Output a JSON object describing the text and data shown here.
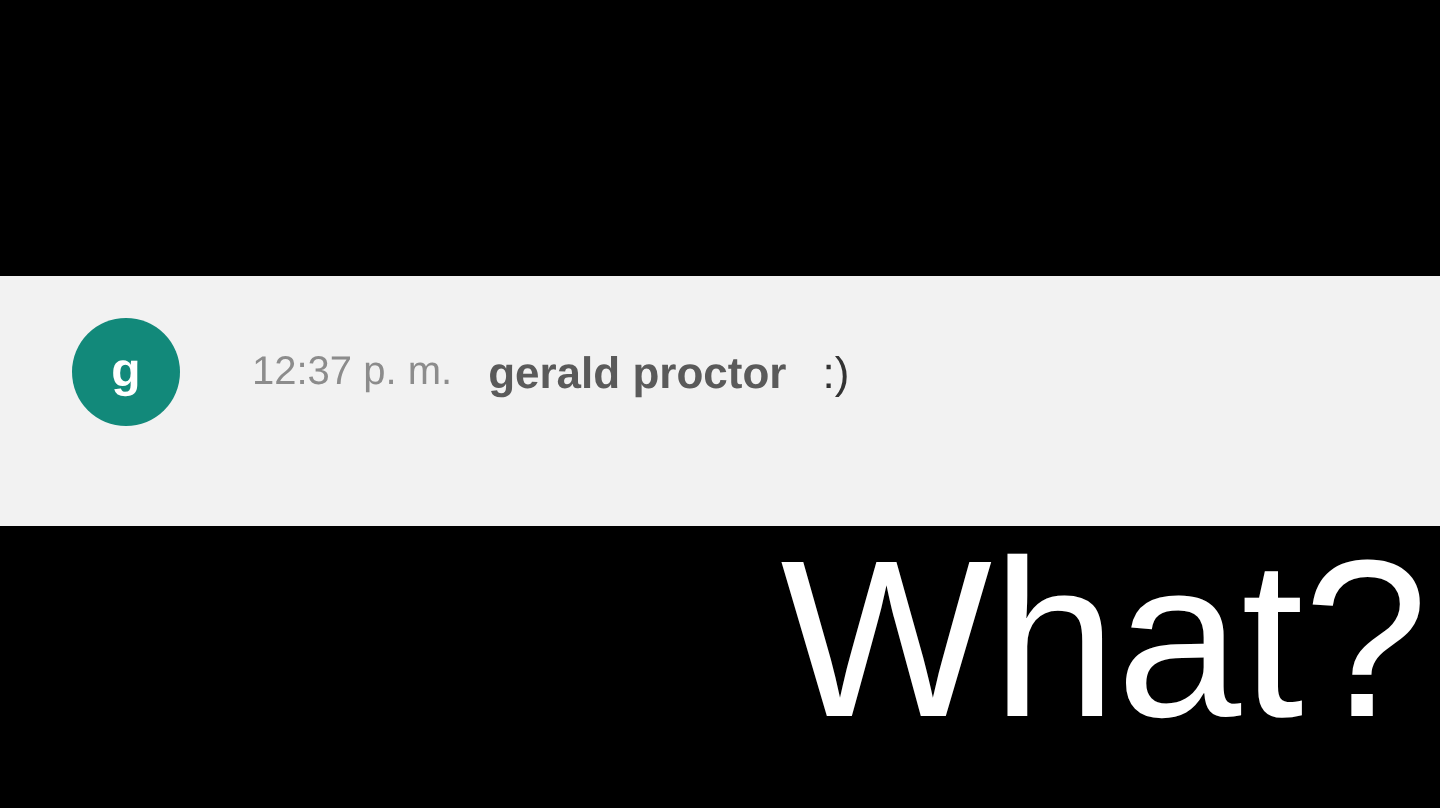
{
  "comment": {
    "avatar_letter": "g",
    "time": "12:37 p. m.",
    "author": "gerald proctor",
    "text": ":)"
  },
  "caption": "What?"
}
